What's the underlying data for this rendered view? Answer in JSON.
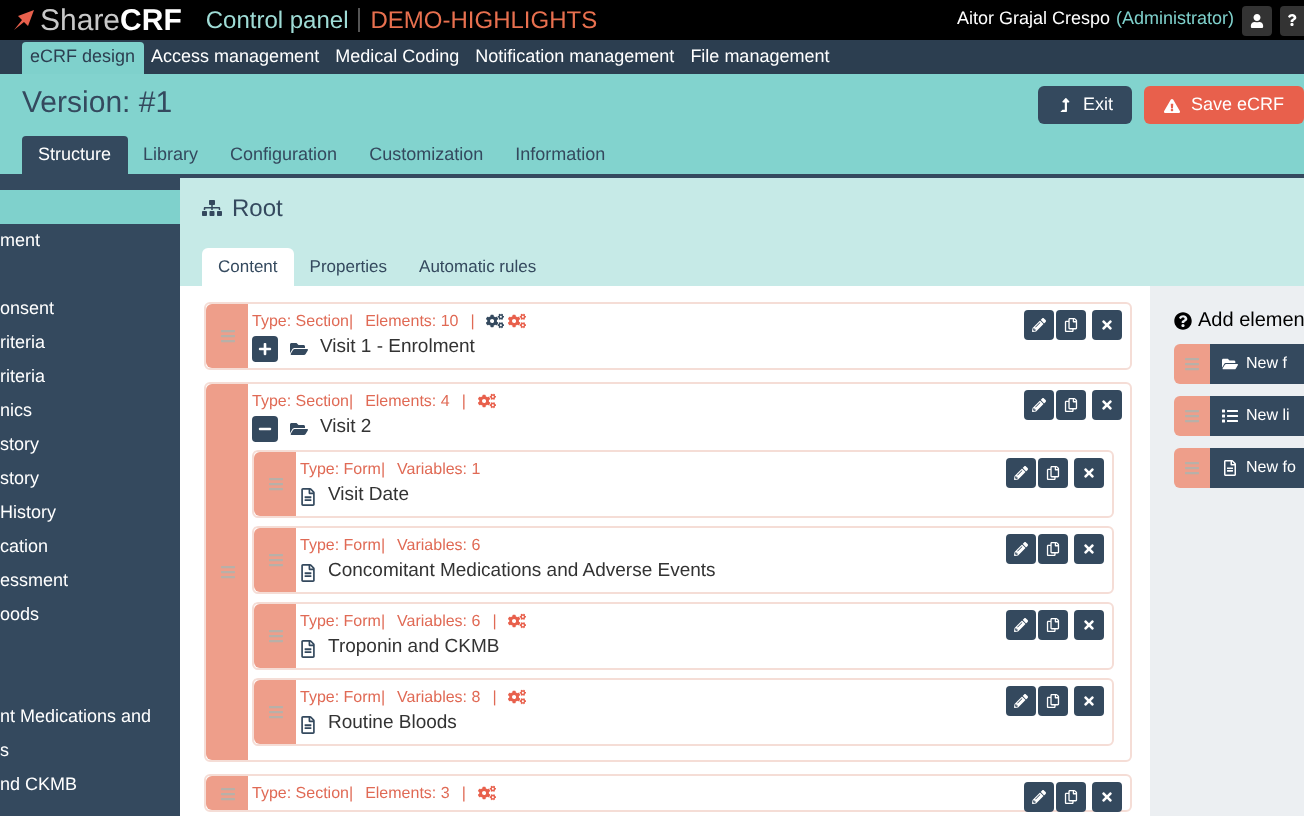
{
  "header": {
    "logo_light": "Share",
    "logo_bold": "CRF",
    "title": "Control panel",
    "project": "DEMO-HIGHLIGHTS",
    "user": "Aitor Grajal Crespo",
    "role": "(Administrator)"
  },
  "nav": [
    {
      "label": "eCRF design",
      "selected": true
    },
    {
      "label": "Access management",
      "selected": false
    },
    {
      "label": "Medical Coding",
      "selected": false
    },
    {
      "label": "Notification management",
      "selected": false
    },
    {
      "label": "File management",
      "selected": false
    }
  ],
  "version_title": "Version: #1",
  "actions": [
    {
      "label": "Exit",
      "kind": "exit"
    },
    {
      "label": "Save eCRF",
      "kind": "save"
    }
  ],
  "tabs": [
    {
      "label": "Structure",
      "selected": true
    },
    {
      "label": "Library",
      "selected": false
    },
    {
      "label": "Configuration",
      "selected": false
    },
    {
      "label": "Customization",
      "selected": false
    },
    {
      "label": "Information",
      "selected": false
    }
  ],
  "sidebar": {
    "items": [
      {
        "selected": true
      },
      {
        "label": "ment",
        "selected": false
      },
      {
        "selected": false
      },
      {
        "label": "onsent",
        "selected": false
      },
      {
        "label": "riteria",
        "selected": false
      },
      {
        "label": "riteria",
        "selected": false
      },
      {
        "label": "nics",
        "selected": false
      },
      {
        "label": "story",
        "selected": false
      },
      {
        "label": "story",
        "selected": false
      },
      {
        "label": "History",
        "selected": false
      },
      {
        "label": "cation",
        "selected": false
      },
      {
        "label": "essment",
        "selected": false
      },
      {
        "label": "oods",
        "selected": false
      },
      {
        "selected": false
      },
      {
        "selected": false
      },
      {
        "label": "nt Medications and",
        "selected": false
      },
      {
        "label": "s",
        "selected": false
      },
      {
        "label": "nd CKMB",
        "selected": false
      }
    ]
  },
  "root_title": "Root",
  "subtabs": [
    {
      "label": "Content",
      "selected": true
    },
    {
      "label": "Properties",
      "selected": false
    },
    {
      "label": "Automatic rules",
      "selected": false
    }
  ],
  "elements": [
    {
      "kind": "section",
      "type": "Type: Section|",
      "count": "Elements: 10",
      "separator": "|",
      "conditions": true,
      "rules": true,
      "expanded": false,
      "name": "Visit 1 - Enrolment"
    },
    {
      "kind": "section",
      "type": "Type: Section|",
      "count": "Elements: 4",
      "separator": "|",
      "conditions": false,
      "rules": true,
      "expanded": true,
      "name": "Visit 2",
      "children": [
        {
          "kind": "form",
          "type": "Type: Form|",
          "count": "Variables: 1",
          "conditions": false,
          "rules": false,
          "name": "Visit Date"
        },
        {
          "kind": "form",
          "type": "Type: Form|",
          "count": "Variables: 6",
          "conditions": false,
          "rules": false,
          "name": "Concomitant Medications and Adverse Events"
        },
        {
          "kind": "form",
          "type": "Type: Form|",
          "count": "Variables: 6",
          "separator": "|",
          "conditions": false,
          "rules": true,
          "name": "Troponin and CKMB"
        },
        {
          "kind": "form",
          "type": "Type: Form|",
          "count": "Variables: 8",
          "separator": "|",
          "conditions": false,
          "rules": true,
          "name": "Routine Bloods"
        }
      ]
    },
    {
      "kind": "section",
      "type": "Type: Section|",
      "count": "Elements: 3",
      "separator": "|",
      "conditions": false,
      "rules": true
    }
  ],
  "add_panel": {
    "title": "Add elemen",
    "buttons": [
      {
        "label": "New f",
        "kind": "folder"
      },
      {
        "label": "New li",
        "kind": "list"
      },
      {
        "label": "New fo",
        "kind": "form"
      }
    ]
  }
}
